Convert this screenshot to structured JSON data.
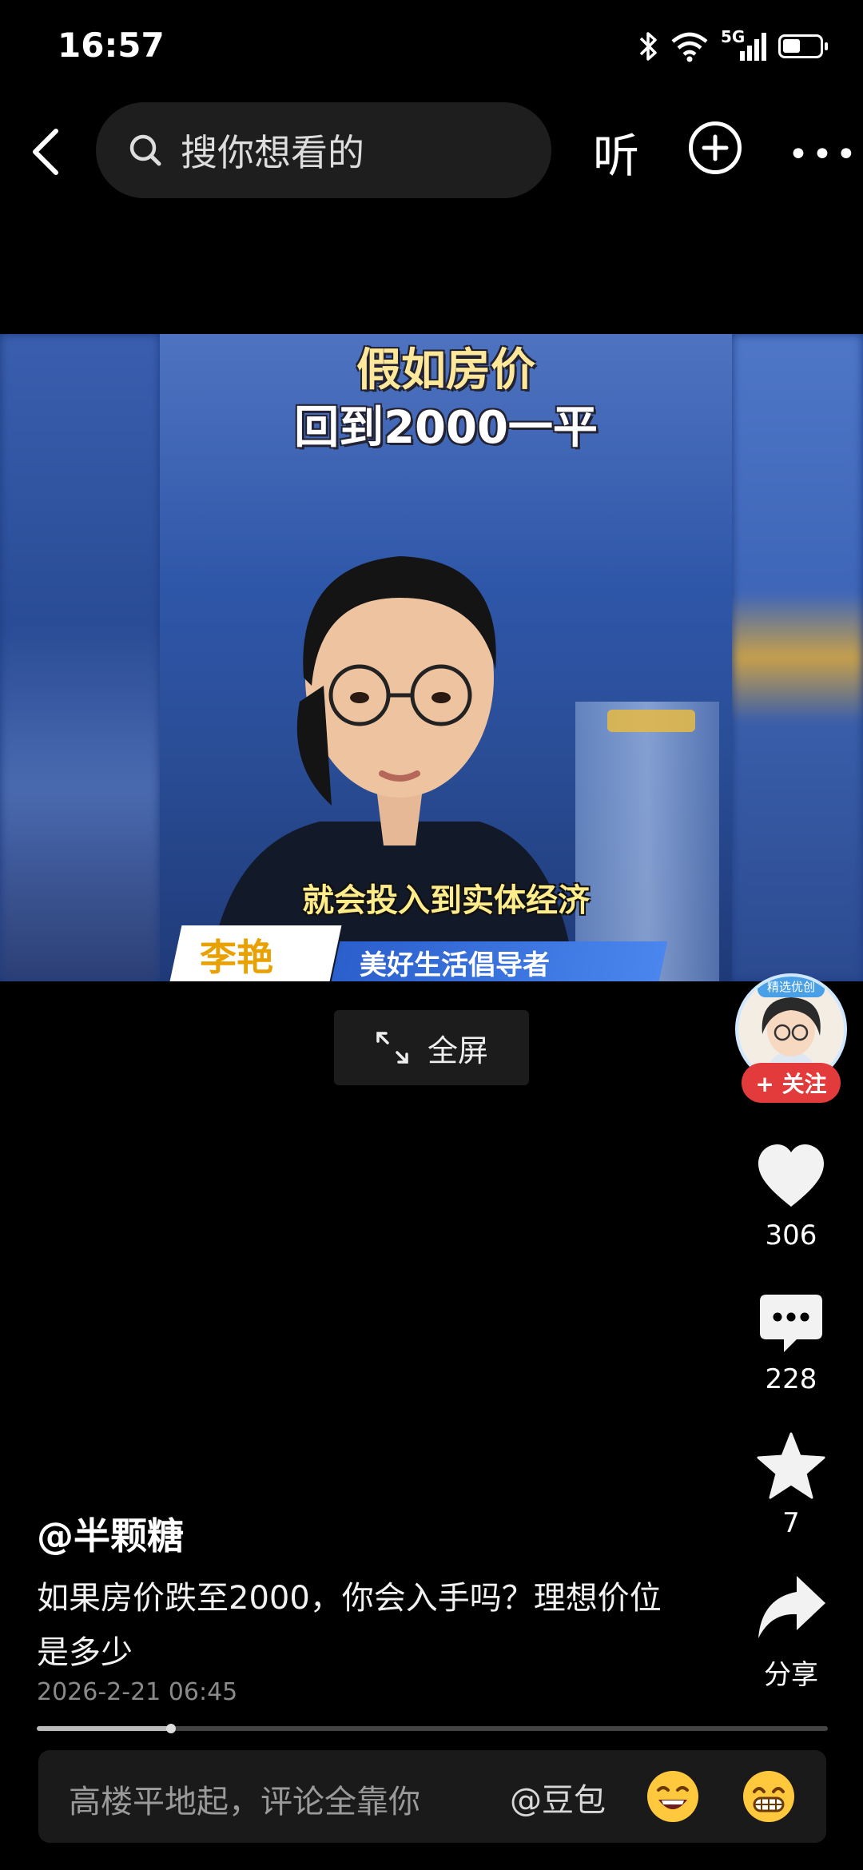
{
  "status_bar": {
    "time": "16:57",
    "network": "5G",
    "battery_level": 0.5
  },
  "top_bar": {
    "search_placeholder": "搜你想看的",
    "listen_label": "听"
  },
  "video": {
    "caption_line1": "假如房价",
    "caption_line2": "回到2000一平",
    "subtitle": "就会投入到实体经济",
    "speaker_name": "李艳",
    "speaker_role": "美好生活倡导者"
  },
  "fullscreen_label": "全屏",
  "right_rail": {
    "follow_label": "+ 关注",
    "likes": "306",
    "comments": "228",
    "favorites": "7",
    "share_label": "分享",
    "avatar_badge": "精选优创"
  },
  "post": {
    "author": "@半颗糖",
    "description": "如果房价跌至2000，你会入手吗？理想价位是多少",
    "date": "2026-2-21 06:45",
    "progress": 0.17
  },
  "comment_bar": {
    "placeholder": "高楼平地起，评论全靠你",
    "mention": "@豆包"
  },
  "icons": [
    "back-icon",
    "search-icon",
    "plus-circle-icon",
    "more-icon",
    "heart-icon",
    "comment-icon",
    "star-icon",
    "share-icon",
    "fullscreen-icon",
    "bluetooth-icon",
    "wifi-icon",
    "signal-icon",
    "battery-icon",
    "grin-emoji-icon",
    "laugh-emoji-icon"
  ]
}
